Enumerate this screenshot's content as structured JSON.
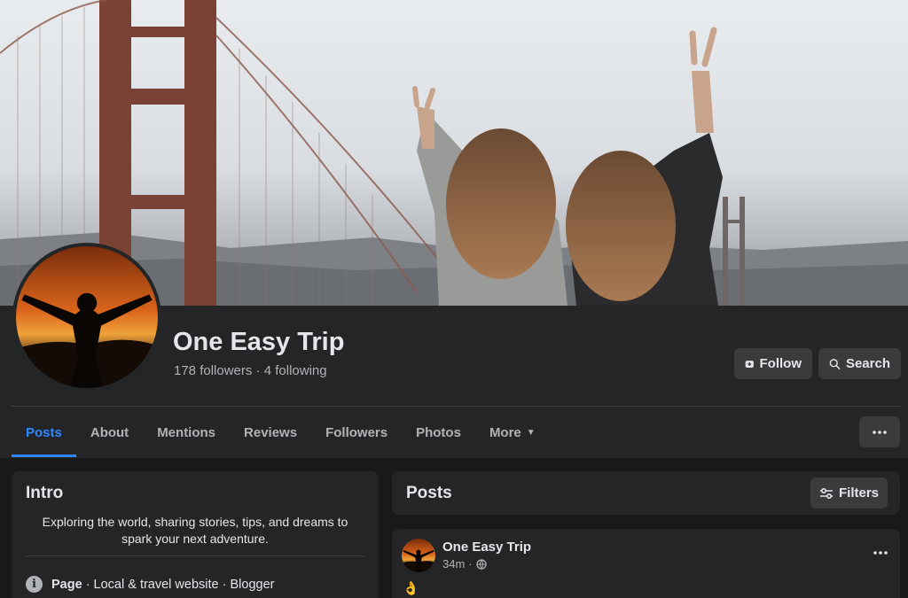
{
  "page": {
    "name": "One Easy Trip",
    "stats": "178 followers · 4 following"
  },
  "header_actions": {
    "follow_label": "Follow",
    "search_label": "Search"
  },
  "tabs": [
    {
      "label": "Posts",
      "active": true
    },
    {
      "label": "About"
    },
    {
      "label": "Mentions"
    },
    {
      "label": "Reviews"
    },
    {
      "label": "Followers"
    },
    {
      "label": "Photos"
    },
    {
      "label": "More"
    }
  ],
  "intro": {
    "title": "Intro",
    "bio": "Exploring the world, sharing stories, tips, and dreams to spark your next adventure.",
    "category_label": "Page",
    "category_value": " · Local & travel website · Blogger"
  },
  "posts_section": {
    "title": "Posts",
    "filters_label": "Filters"
  },
  "post": {
    "author": "One Easy Trip",
    "time": "34m",
    "separator": "·",
    "emoji": "👌"
  },
  "colors": {
    "accent": "#2d88ff",
    "background": "#18191a",
    "card": "#242526",
    "button": "#3a3b3c"
  }
}
